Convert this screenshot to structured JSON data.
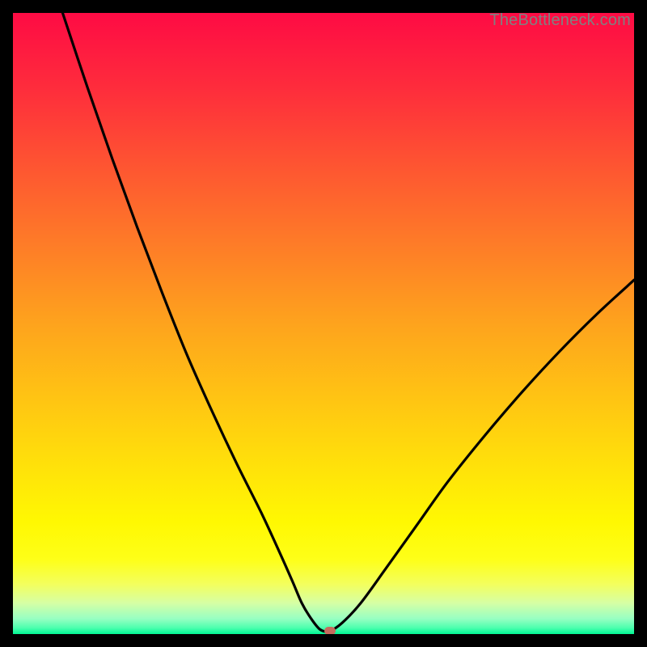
{
  "watermark": "TheBottleneck.com",
  "marker_color": "#c66b5d",
  "gradient_stops": [
    {
      "offset": 0.0,
      "color": "#fe0b44"
    },
    {
      "offset": 0.12,
      "color": "#fe2c3c"
    },
    {
      "offset": 0.25,
      "color": "#fe5631"
    },
    {
      "offset": 0.38,
      "color": "#fe7e27"
    },
    {
      "offset": 0.5,
      "color": "#fea31d"
    },
    {
      "offset": 0.62,
      "color": "#ffc413"
    },
    {
      "offset": 0.74,
      "color": "#ffe409"
    },
    {
      "offset": 0.82,
      "color": "#fff802"
    },
    {
      "offset": 0.88,
      "color": "#feff18"
    },
    {
      "offset": 0.92,
      "color": "#f3ff5e"
    },
    {
      "offset": 0.95,
      "color": "#d6ffa5"
    },
    {
      "offset": 0.975,
      "color": "#98ffc2"
    },
    {
      "offset": 0.99,
      "color": "#4cffae"
    },
    {
      "offset": 1.0,
      "color": "#00f793"
    }
  ],
  "chart_data": {
    "type": "line",
    "title": "",
    "xlabel": "",
    "ylabel": "",
    "xlim": [
      0,
      100
    ],
    "ylim": [
      0,
      100
    ],
    "series": [
      {
        "name": "curve",
        "x": [
          8,
          12,
          16,
          20,
          24,
          28,
          32,
          36,
          40,
          43,
          45,
          46.5,
          48,
          49.5,
          51,
          53,
          56,
          60,
          65,
          70,
          76,
          82,
          88,
          94,
          100
        ],
        "y": [
          100,
          88,
          76.5,
          65.5,
          55,
          45,
          36,
          27.5,
          19.5,
          13,
          8.5,
          5,
          2.5,
          0.7,
          0.5,
          1.8,
          5,
          10.5,
          17.5,
          24.5,
          32,
          39,
          45.5,
          51.5,
          57
        ]
      }
    ],
    "flat_bottom": {
      "x_start": 46.5,
      "x_end": 51,
      "y": 0.5
    },
    "marker": {
      "x": 51,
      "y": 0.5
    }
  }
}
